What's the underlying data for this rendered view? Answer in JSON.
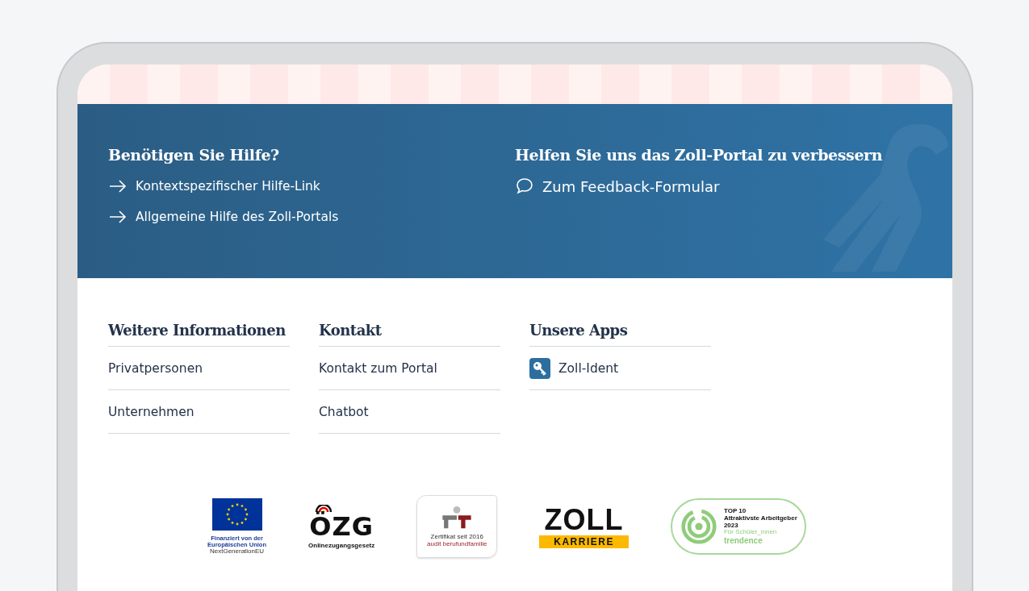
{
  "help_panels": [
    {
      "title": "Benötigen Sie Hilfe?",
      "links": [
        {
          "label": "Kontextspezifischer Hilfe-Link",
          "kind": "arrow"
        },
        {
          "label": "Allgemeine Hilfe des Zoll-Portals",
          "kind": "arrow"
        }
      ]
    },
    {
      "title": "Helfen Sie uns das Zoll-Portal zu verbessern",
      "links": [
        {
          "label": "Zum Feedback-Formular",
          "kind": "chat"
        }
      ]
    }
  ],
  "footer_columns": [
    {
      "title": "Weitere Informationen",
      "items": [
        {
          "label": "Privatpersonen",
          "kind": "text"
        },
        {
          "label": "Unternehmen",
          "kind": "text"
        }
      ]
    },
    {
      "title": "Kontakt",
      "items": [
        {
          "label": "Kontakt zum Portal",
          "kind": "text"
        },
        {
          "label": "Chatbot",
          "kind": "text"
        }
      ]
    },
    {
      "title": "Unsere Apps",
      "items": [
        {
          "label": "Zoll-Ident",
          "kind": "app"
        }
      ]
    }
  ],
  "logos": [
    {
      "kind": "eu",
      "lines": [
        "Finanziert von der",
        "Europäischen Union"
      ],
      "sub": "NextGenerationEU"
    },
    {
      "kind": "ozg",
      "mark": "ÖZG",
      "sub": "Onlinezugangsgesetz"
    },
    {
      "kind": "audit",
      "lines": [
        "Zertifikat seit 2016"
      ],
      "sub": "audit berufundfamilie"
    },
    {
      "kind": "zoll",
      "mark": "ZOLL",
      "sub": "KARRIERE"
    },
    {
      "kind": "trendence",
      "lines": [
        "TOP 10",
        "Attraktivste Arbeitgeber",
        "2023"
      ],
      "note": "Für Schüler_innen",
      "sub": "trendence"
    }
  ]
}
